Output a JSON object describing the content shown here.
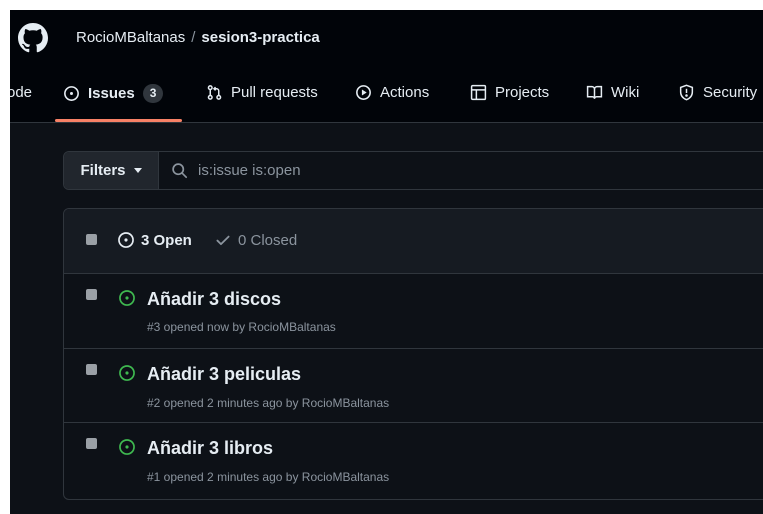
{
  "header": {
    "owner": "RocioMBaltanas",
    "separator": "/",
    "repo": "sesion3-practica"
  },
  "tabs": [
    {
      "label": "ode",
      "icon": "code-icon"
    },
    {
      "label": "Issues",
      "count": "3",
      "icon": "issue-opened-icon",
      "active": true
    },
    {
      "label": "Pull requests",
      "icon": "git-pull-request-icon"
    },
    {
      "label": "Actions",
      "icon": "play-icon"
    },
    {
      "label": "Projects",
      "icon": "table-icon"
    },
    {
      "label": "Wiki",
      "icon": "book-icon"
    },
    {
      "label": "Security",
      "icon": "shield-icon"
    }
  ],
  "filters": {
    "button_label": "Filters",
    "search_value": "is:issue is:open"
  },
  "issue_list": {
    "open_label": "3 Open",
    "closed_label": "0 Closed",
    "issues": [
      {
        "title": "Añadir 3 discos",
        "meta": "#3 opened now by RocioMBaltanas"
      },
      {
        "title": "Añadir 3 peliculas",
        "meta": "#2 opened 2 minutes ago by RocioMBaltanas"
      },
      {
        "title": "Añadir 3 libros",
        "meta": "#1 opened 2 minutes ago by RocioMBaltanas"
      }
    ]
  },
  "colors": {
    "background": "#0d1117",
    "header_bg": "#010409",
    "border": "#30363d",
    "open_green": "#3fb950",
    "active_underline": "#f78166",
    "muted_text": "#8b949e"
  }
}
